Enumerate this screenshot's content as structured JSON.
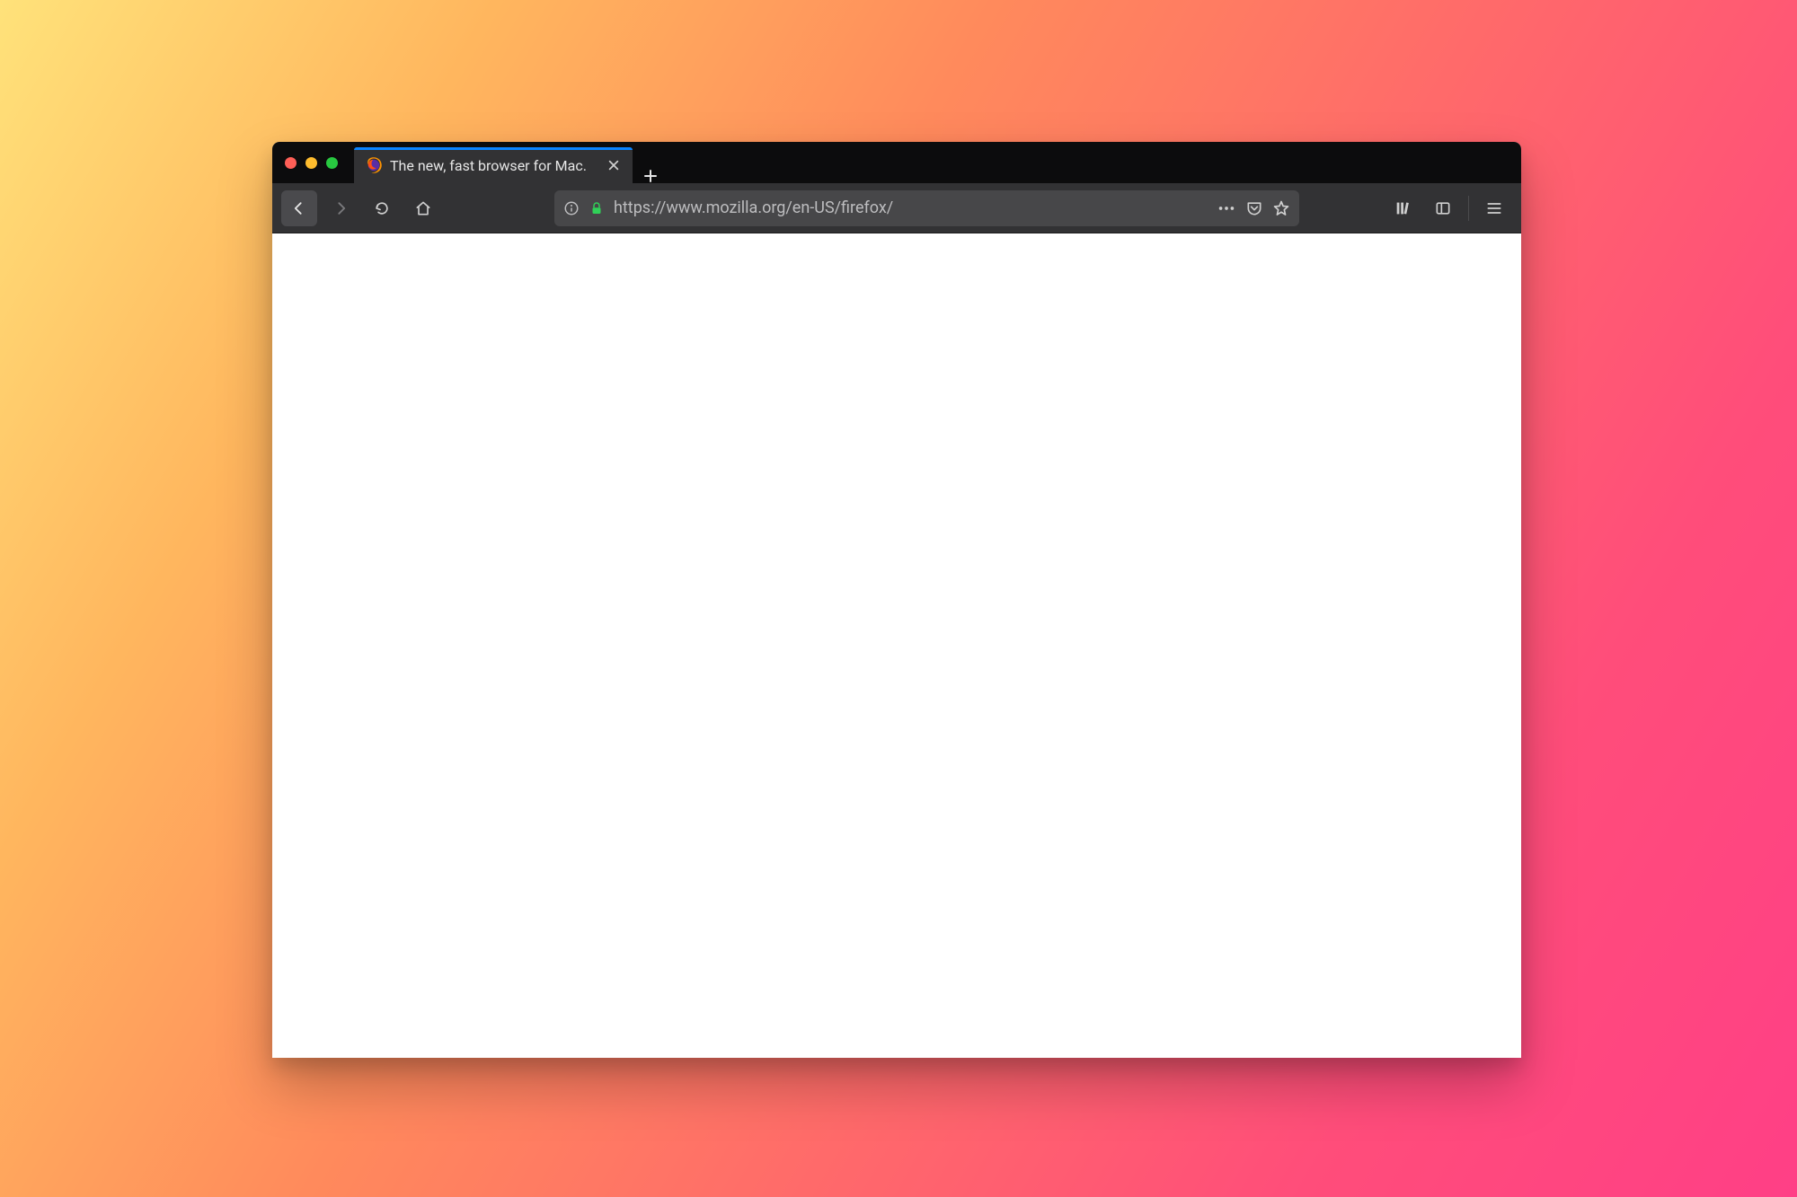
{
  "tab": {
    "title": "The new, fast browser for Mac."
  },
  "urlbar": {
    "url": "https://www.mozilla.org/en-US/firefox/"
  }
}
